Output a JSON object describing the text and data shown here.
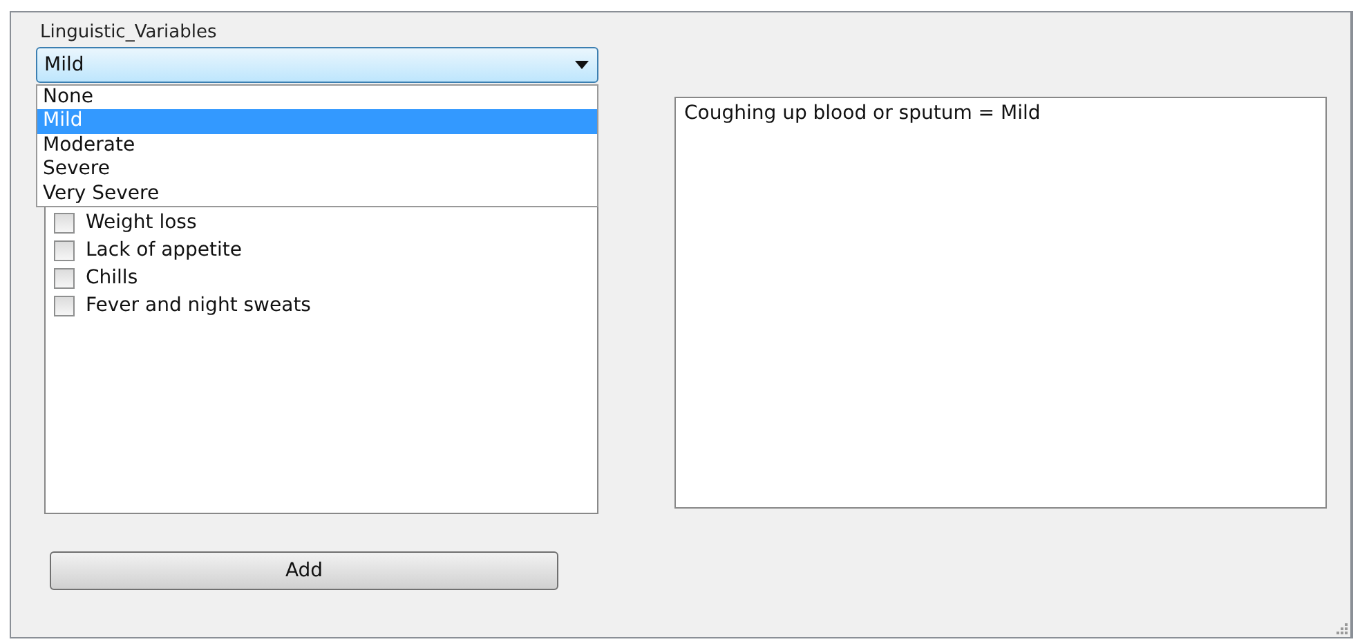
{
  "label": "Linguistic_Variables",
  "combo": {
    "value": "Mild",
    "expanded": true,
    "options": [
      {
        "label": "None",
        "selected": false
      },
      {
        "label": "Mild",
        "selected": true
      },
      {
        "label": "Moderate",
        "selected": false
      },
      {
        "label": "Severe",
        "selected": false
      },
      {
        "label": "Very Severe",
        "selected": false
      }
    ]
  },
  "symptoms": [
    {
      "label": "Weight loss",
      "checked": false
    },
    {
      "label": "Lack of appetite",
      "checked": false
    },
    {
      "label": "Chills",
      "checked": false
    },
    {
      "label": "Fever and night sweats",
      "checked": false
    }
  ],
  "output": "Coughing up blood or sputum = Mild",
  "buttons": [
    "Add"
  ]
}
